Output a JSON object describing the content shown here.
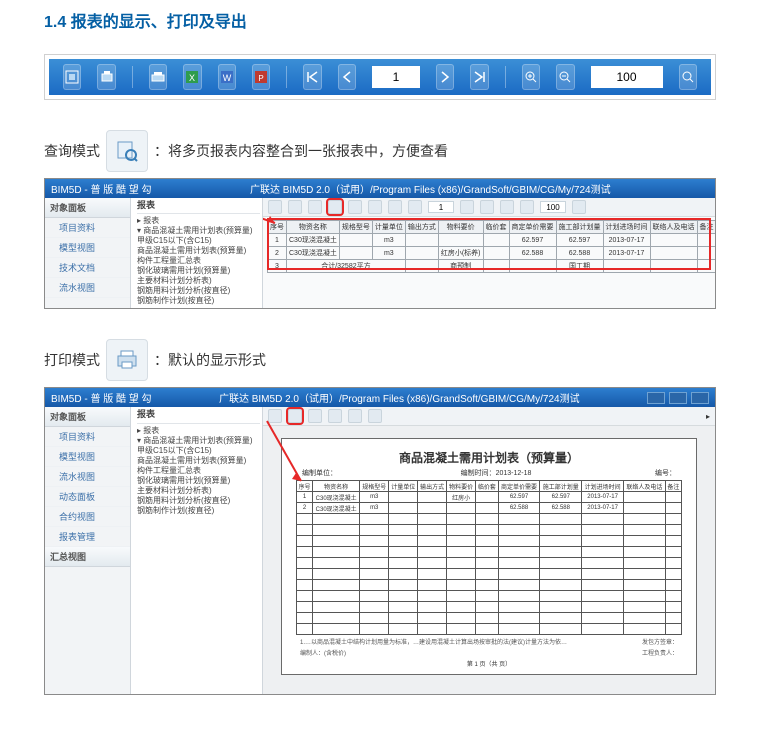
{
  "heading": "1.4 报表的显示、打印及导出",
  "toolbar": {
    "page_value": "1",
    "zoom_value": "100"
  },
  "caption_query": {
    "label": "查询模式",
    "desc": "：将多页报表内容整合到一张报表中，方便查看"
  },
  "caption_print": {
    "label": "打印模式",
    "desc": "：默认的显示形式"
  },
  "app": {
    "title_left": "BIM5D - 普 版 酷 望 勾",
    "title_center": "广联达 BIM5D 2.0（试用）/Program Files (x86)/GrandSoft/GBIM/CG/My/724测试",
    "sidebar": {
      "head": "对象面板",
      "items": [
        "项目资料",
        "模型视图",
        "技术文档",
        "流水视图",
        "动态面板",
        "合约视图",
        "报表管理"
      ]
    },
    "tree": {
      "head": "报表",
      "lines": [
        "▸ 报表",
        " ▾ 商品混凝土需用计划表(预算量)",
        "   甲级C15以下(含C15)",
        "   商品混凝土需用计划表(预算量)",
        "   构件工程量汇总表",
        "   钢化玻璃需用计划(预算量)",
        "   主要材料计划分析表)",
        "   钢筋用料计划分析(按直径)",
        "   钢筋制作计划(按直径)"
      ]
    },
    "innerbar": {
      "page": "1",
      "zoom": "100"
    },
    "columns": [
      "序号",
      "物资名称",
      "规格型号",
      "计量单位",
      "输出方式",
      "物料要价",
      "临价套",
      "商定单价需要",
      "施工部计划量",
      "计划进场时间",
      "联络人及电话",
      "备注"
    ],
    "rows": [
      {
        "c": [
          "1",
          "C30现浇混凝土",
          "",
          "m3",
          "",
          "",
          "",
          "62.597",
          "62.597",
          "2013-07-17",
          "",
          ""
        ]
      },
      {
        "c": [
          "2",
          "C30现浇混凝土",
          "",
          "m3",
          "",
          "红房小(标养)",
          "",
          "62.588",
          "62.588",
          "2013-07-17",
          "",
          ""
        ]
      },
      {
        "c": [
          "3",
          "",
          "",
          "",
          "",
          "商预制",
          "",
          "",
          "国工期",
          "",
          "",
          ""
        ]
      }
    ],
    "summary_label": "合计/32582平方"
  },
  "paper": {
    "title": "商品混凝土需用计划表（预算量）",
    "sub_left": "编制单位：",
    "sub_center": "编制时间：2013-12-18",
    "sub_right": "编号：",
    "columns": [
      "序号",
      "物资名称",
      "规格型号",
      "计量单位",
      "输出方式",
      "物料要价",
      "临价套",
      "商定单价需要",
      "施工部计划量",
      "计划进场时间",
      "联络人及电话",
      "备注"
    ],
    "rows": [
      {
        "c": [
          "1",
          "C30现浇混凝土",
          "m3",
          "",
          "",
          "红房小",
          "",
          "62.597",
          "62.597",
          "2013-07-17",
          "",
          ""
        ]
      },
      {
        "c": [
          "2",
          "C30现浇混凝土",
          "m3",
          "",
          "",
          "",
          "",
          "62.588",
          "62.588",
          "2013-07-17",
          "",
          ""
        ]
      }
    ],
    "foot1_l": "1.…以商品混凝土中结构计划用量为标准，…建设用混凝土计算出场按审批的法(建议)计量方法为依…",
    "foot1_r": "发包方签章：",
    "foot2_l": "编制人：(含税价)",
    "foot2_r": "工程负责人：",
    "page": "第 1 页（共 页）"
  }
}
